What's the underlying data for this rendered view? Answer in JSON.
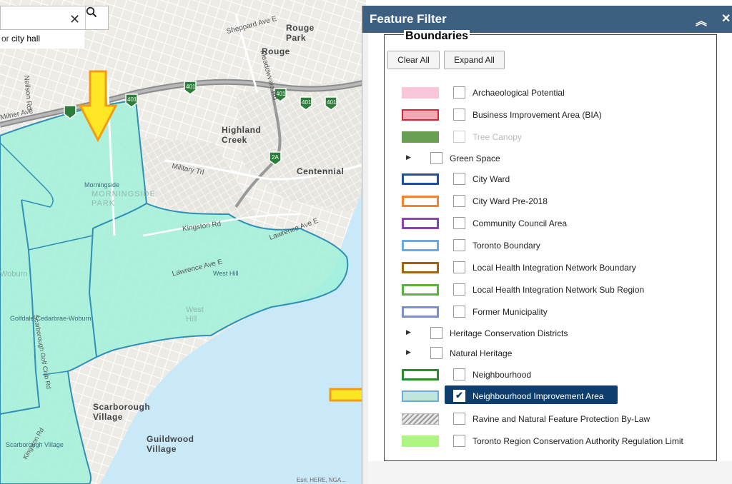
{
  "map": {
    "search_hint_prefix": "or ",
    "search_hint_term": "city hall",
    "labels": {
      "sheppard": "Sheppard Ave E",
      "rouge_park": "Rouge Park",
      "rouge": "Rouge",
      "meadowvale": "Meadowvale Rd",
      "highland_creek": "Highland Creek",
      "centennial": "Centennial",
      "military": "Military Trl",
      "morningside": "Morningside",
      "morningside_park": "MORNINGSIDE PARK",
      "kingston": "Kingston Rd",
      "lawrence_e1": "Lawrence Ave E",
      "lawrence_e2": "Lawrence Ave E",
      "west_hill": "West Hill",
      "west_hill_big": "West Hill",
      "woburn": "Woburn",
      "golfdale": "Golfdale-Cedarbrae-Woburn",
      "scarborough_golf": "Scarborough Golf Club Rd",
      "scarborough_village": "Scarborough Village",
      "scarborough_village_small": "Scarborough Village",
      "guildwood": "Guildwood Village",
      "kingston_rd2": "Kingston Rd",
      "neilson": "Neilson Rd",
      "milner": "Milner Ave",
      "ellesmere": "",
      "attribution": "Esri, HERE, NGA..."
    },
    "shields": [
      "401",
      "401",
      "401",
      "401",
      "401",
      "2A"
    ]
  },
  "panel": {
    "title": "Feature Filter",
    "section_title": "Boundaries",
    "clear_all": "Clear All",
    "expand_all": "Expand All",
    "items": [
      {
        "label": "Archaeological Potential",
        "checked": false,
        "swatch": "#f9c5d8"
      },
      {
        "label": "Business Improvement Area (BIA)",
        "checked": false,
        "swatch": "#f4a8b4"
      },
      {
        "label": "Tree Canopy",
        "checked": false,
        "swatch": "#6a9e52",
        "disabled": true
      },
      {
        "label": "Green Space",
        "checked": false,
        "sub": true
      },
      {
        "label": "City Ward",
        "checked": false,
        "swatch": "#1f4ea1"
      },
      {
        "label": "City Ward Pre-2018",
        "checked": false,
        "swatch": "#f58233"
      },
      {
        "label": "Community Council Area",
        "checked": false,
        "swatch": "#8e44ad"
      },
      {
        "label": "Toronto Boundary",
        "checked": false,
        "swatch": "#6fa8dc"
      },
      {
        "label": "Local Health Integration Network Boundary",
        "checked": false,
        "swatch": "#a0650f"
      },
      {
        "label": "Local Health Integration Network Sub Region",
        "checked": false,
        "swatch": "#56b43c"
      },
      {
        "label": "Former Municipality",
        "checked": false,
        "swatch": "#7b8fc8"
      },
      {
        "label": "Heritage Conservation Districts",
        "checked": false,
        "sub": true
      },
      {
        "label": "Natural Heritage",
        "checked": false,
        "sub": true
      },
      {
        "label": "Neighbourhood",
        "checked": false,
        "swatch": "#2e8b2e"
      },
      {
        "label": "Neighbourhood Improvement Area",
        "checked": true,
        "swatch": "#bfe6dc",
        "selected": true
      },
      {
        "label": "Ravine and Natural Feature Protection By-Law",
        "checked": false,
        "swatch": "hatch"
      },
      {
        "label": "Toronto Region Conservation Authority Regulation Limit",
        "checked": false,
        "swatch": "#adf57f"
      }
    ]
  },
  "colors": {
    "header": "#3d5f80",
    "selected": "#0d3e6d",
    "nia_fill": "#9ef0d8",
    "water": "#c9e9f9",
    "arrow_fill": "#fde725",
    "arrow_stroke": "#f39c12"
  }
}
